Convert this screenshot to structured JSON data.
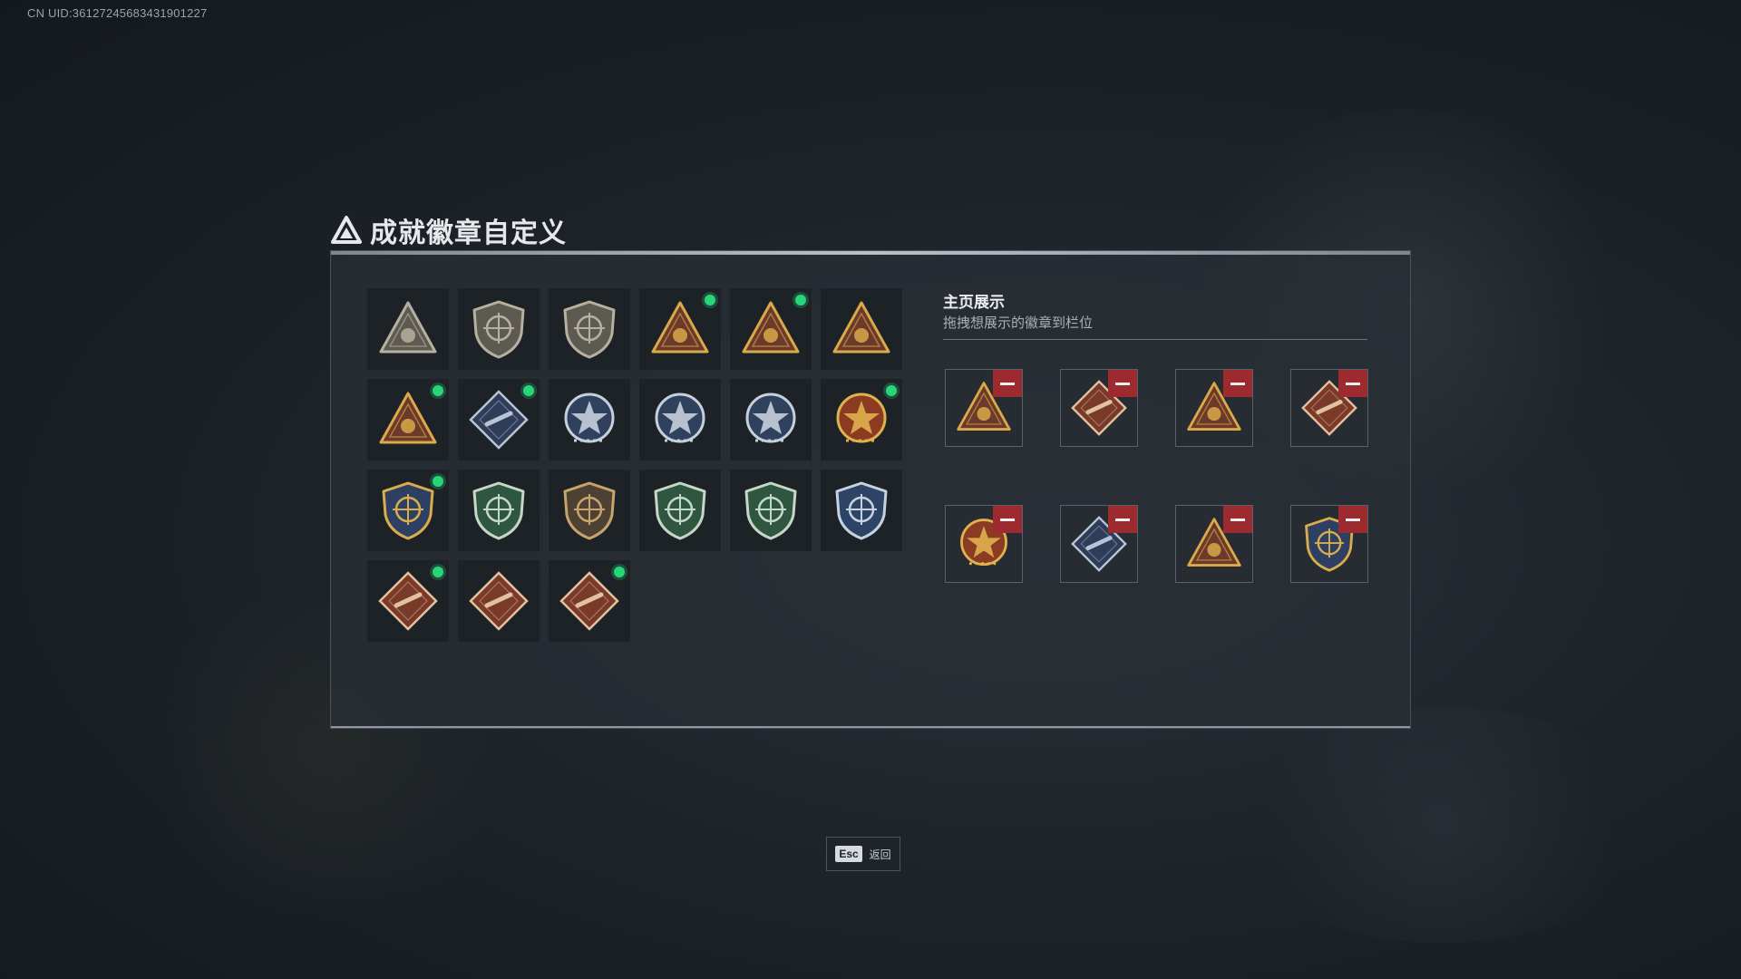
{
  "header": {
    "uid": "CN UID:361272456834319012​27"
  },
  "panel": {
    "title": "成就徽章自定义"
  },
  "badges": [
    {
      "icon": "triangle-emblem-shield-badge-icon",
      "color": "#5d5a52",
      "accent": "#b7b0a0",
      "new": false
    },
    {
      "icon": "helicopter-shield-badge-icon",
      "color": "#5d5a52",
      "accent": "#b7b0a0",
      "new": false
    },
    {
      "icon": "dagger-shield-badge-icon",
      "color": "#5d5a52",
      "accent": "#b7b0a0",
      "new": false
    },
    {
      "icon": "gold-triangle-helmet-badge-icon",
      "color": "#6b3a2a",
      "accent": "#d9a94a",
      "new": true
    },
    {
      "icon": "gold-triangle-cannon-badge-icon",
      "color": "#6b3a2a",
      "accent": "#d9a94a",
      "new": true
    },
    {
      "icon": "gold-triangle-number-one-badge-icon",
      "color": "#6b3a2a",
      "accent": "#d9a94a",
      "new": false
    },
    {
      "icon": "gold-triangle-ammo-badge-icon",
      "color": "#6b3a2a",
      "accent": "#d9a94a",
      "new": true
    },
    {
      "icon": "rocket-launcher-diamond-badge-icon",
      "color": "#2f3d58",
      "accent": "#b8c4d8",
      "new": true
    },
    {
      "icon": "silver-star-medal-badge-icon",
      "color": "#30415e",
      "accent": "#c6cfdc",
      "new": false
    },
    {
      "icon": "silver-police-badge-icon",
      "color": "#30415e",
      "accent": "#c6cfdc",
      "new": false
    },
    {
      "icon": "silver-skull-medal-badge-icon",
      "color": "#30415e",
      "accent": "#c6cfdc",
      "new": false
    },
    {
      "icon": "gold-tank-explosion-badge-icon",
      "color": "#8a3b22",
      "accent": "#e0b14f",
      "new": true
    },
    {
      "icon": "gold-crosshair-shield-badge-icon",
      "color": "#2d3f62",
      "accent": "#d9ad4c",
      "new": true
    },
    {
      "icon": "green-crosshair-shield-badge-icon",
      "color": "#2f5641",
      "accent": "#c5d7c6",
      "new": false
    },
    {
      "icon": "bronze-crossed-shield-badge-icon",
      "color": "#4c4133",
      "accent": "#c7a46b",
      "new": false
    },
    {
      "icon": "green-crosshair-shield-badge-icon",
      "color": "#2f5641",
      "accent": "#c5d7c6",
      "new": false
    },
    {
      "icon": "green-crosshair-shield-badge-icon",
      "color": "#2f5641",
      "accent": "#c5d7c6",
      "new": false
    },
    {
      "icon": "blue-crosshair-shield-badge-icon",
      "color": "#2d4466",
      "accent": "#c7d2e0",
      "new": false
    },
    {
      "icon": "red-diamond-dragon-badge-icon",
      "color": "#7a3a2a",
      "accent": "#e2c1a0",
      "new": true
    },
    {
      "icon": "red-diamond-soldier-badge-icon",
      "color": "#7a3a2a",
      "accent": "#e2c1a0",
      "new": false
    },
    {
      "icon": "red-diamond-rifle-badge-icon",
      "color": "#7a3a2a",
      "accent": "#e2c1a0",
      "new": true
    }
  ],
  "showcase": {
    "title": "主页展示",
    "subtitle": "拖拽想展示的徽章到栏位",
    "slots": [
      {
        "icon": "gold-triangle-helmet-badge-icon",
        "color": "#6b3a2a",
        "accent": "#d9a94a"
      },
      {
        "icon": "red-diamond-dragon-badge-icon",
        "color": "#7a3a2a",
        "accent": "#e2c1a0"
      },
      {
        "icon": "gold-triangle-ammo-badge-icon",
        "color": "#6b3a2a",
        "accent": "#d9a94a"
      },
      {
        "icon": "red-diamond-rifle-badge-icon",
        "color": "#7a3a2a",
        "accent": "#e2c1a0"
      },
      {
        "icon": "gold-tank-explosion-badge-icon",
        "color": "#8a3b22",
        "accent": "#e0b14f"
      },
      {
        "icon": "rocket-launcher-diamond-badge-icon",
        "color": "#2f3d58",
        "accent": "#b8c4d8"
      },
      {
        "icon": "gold-triangle-cannon-badge-icon",
        "color": "#6b3a2a",
        "accent": "#d9a94a"
      },
      {
        "icon": "gold-crosshair-shield-badge-icon",
        "color": "#2d3f62",
        "accent": "#d9ad4c"
      }
    ]
  },
  "footer": {
    "esc_key": "Esc",
    "esc_label": "返回"
  }
}
